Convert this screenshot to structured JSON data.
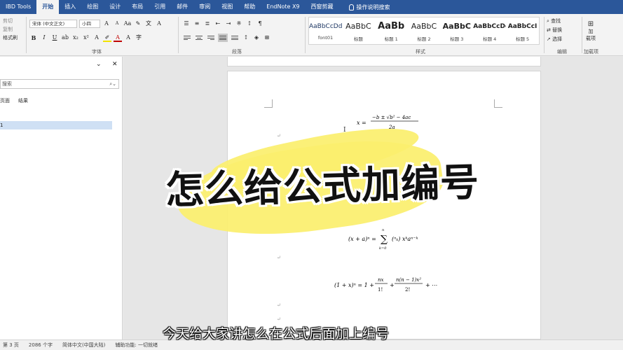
{
  "tabs": [
    "IBD Tools",
    "开始",
    "插入",
    "绘图",
    "设计",
    "布局",
    "引用",
    "邮件",
    "审阅",
    "视图",
    "帮助",
    "EndNote X9",
    "西窗剪藏"
  ],
  "active_tab": "开始",
  "help_search": "操作说明搜索",
  "clipboard": {
    "cut": "剪切",
    "copy": "复制",
    "format_painter": "格式刷"
  },
  "font": {
    "name": "宋体 (中文正文)",
    "size": "小四",
    "bold": "B",
    "italic": "I",
    "underline": "U",
    "grow": "A",
    "shrink": "A",
    "color_glyph": "A",
    "group_label": "字体"
  },
  "paragraph": {
    "group_label": "段落"
  },
  "styles": {
    "group_label": "样式",
    "items": [
      {
        "preview": "AaBbCcDdI",
        "name": "font01"
      },
      {
        "preview": "AaBbC",
        "name": "标题"
      },
      {
        "preview": "AaBb",
        "name": "标题 1"
      },
      {
        "preview": "AaBbC",
        "name": "标题 2"
      },
      {
        "preview": "AaBbC",
        "name": "标题 3"
      },
      {
        "preview": "AaBbCcDc",
        "name": "标题 4"
      },
      {
        "preview": "AaBbCcI",
        "name": "标题 5"
      }
    ]
  },
  "editing": {
    "find": "查找",
    "replace": "替换",
    "select": "选择",
    "group_label": "编辑"
  },
  "addin": {
    "line1": "加",
    "line2": "载项",
    "group_label": "加载项"
  },
  "nav_pane": {
    "search_placeholder": "搜索",
    "tab_pages": "页面",
    "tab_results": "结果",
    "item_partial": "1"
  },
  "doc": {
    "eq1": "x = −b ± √(b² − 4ac) / 2a",
    "eq1_label": "4ac",
    "eq2": "(x + a)ⁿ = Σₖ₌₀ⁿ (ⁿₖ) xᵏ aⁿ⁻ᵏ",
    "eq3": "(1 + x)ⁿ = 1 + nx/1! + n(n − 1)x²/2! + ⋯",
    "para_mark": "↵"
  },
  "status": {
    "page": "第 3 页",
    "words": "2086 个字",
    "lang": "简体中文(中国大陆)",
    "accessibility": "辅助功能: 一切就绪"
  },
  "overlay": {
    "title": "怎么给公式加编号",
    "subtitle": "今天给大家讲怎么在公式后面加上编号"
  }
}
